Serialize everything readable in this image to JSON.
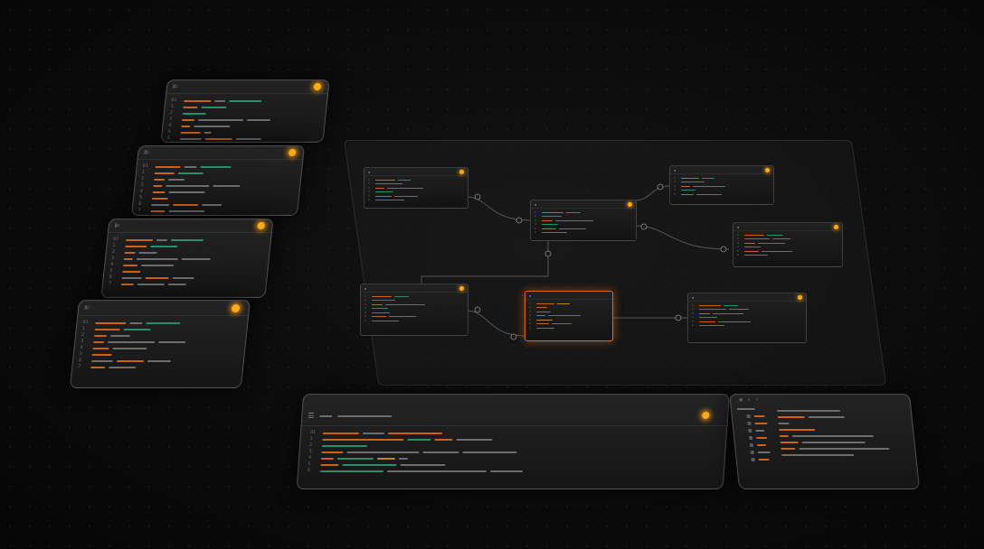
{
  "colors": {
    "accent": "#ffab18",
    "keyword": "#c9621b",
    "string": "#2d8b6a",
    "text": "#6d6d6d",
    "background": "#0b0b0b"
  },
  "left_stack": {
    "cards": [
      {
        "icon": "terminal-icon",
        "status": "active",
        "lines": 7
      },
      {
        "icon": "terminal-icon",
        "status": "active",
        "lines": 7
      },
      {
        "icon": "terminal-icon",
        "status": "active",
        "lines": 7
      },
      {
        "icon": "terminal-icon",
        "status": "active",
        "lines": 7
      }
    ]
  },
  "graph": {
    "nodes": [
      {
        "id": "n1",
        "status": "active"
      },
      {
        "id": "n2",
        "status": "active"
      },
      {
        "id": "n3",
        "status": "active"
      },
      {
        "id": "n4",
        "status": "active"
      },
      {
        "id": "n5",
        "status": "active"
      },
      {
        "id": "n6",
        "status": "selected"
      },
      {
        "id": "n7",
        "status": "active"
      }
    ]
  },
  "editor": {
    "icon": "menu-icon",
    "status": "active",
    "lines": 8
  },
  "sidebar": {
    "icons": [
      "files-icon",
      "search-icon",
      "branch-icon"
    ],
    "rows": 8
  }
}
